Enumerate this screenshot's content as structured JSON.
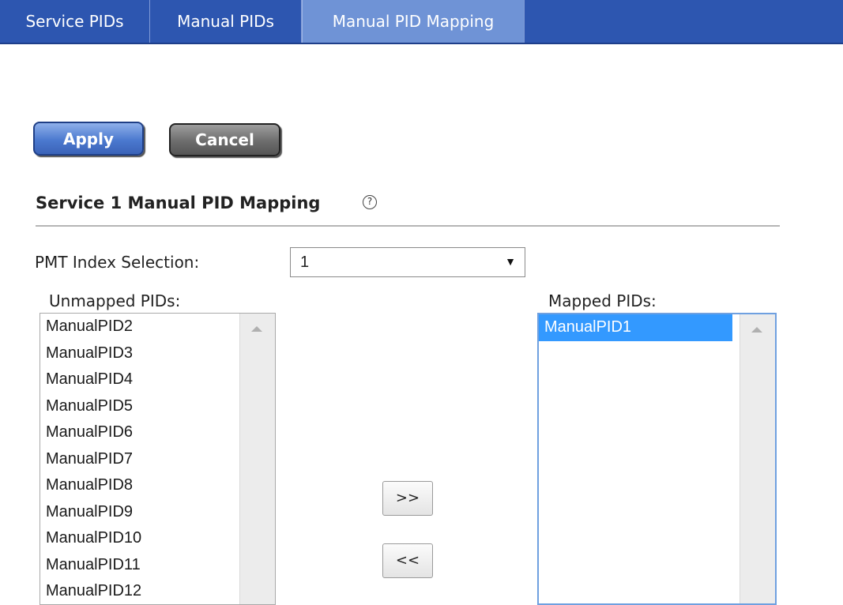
{
  "tabs": [
    {
      "label": "Service PIDs"
    },
    {
      "label": "Manual PIDs"
    },
    {
      "label": "Manual PID Mapping",
      "active": true
    }
  ],
  "buttons": {
    "apply": "Apply",
    "cancel": "Cancel",
    "move_right": ">>",
    "move_left": "<<"
  },
  "section": {
    "title": "Service 1 Manual PID Mapping",
    "help_icon": "?"
  },
  "pmt": {
    "label": "PMT Index Selection:",
    "value": "1"
  },
  "unmapped": {
    "label": "Unmapped PIDs:",
    "items": [
      "ManualPID2",
      "ManualPID3",
      "ManualPID4",
      "ManualPID5",
      "ManualPID6",
      "ManualPID7",
      "ManualPID8",
      "ManualPID9",
      "ManualPID10",
      "ManualPID11",
      "ManualPID12"
    ]
  },
  "mapped": {
    "label": "Mapped PIDs:",
    "items": [
      "ManualPID1"
    ]
  },
  "colors": {
    "tabbar": "#2d56b0",
    "active_tab": "#6f93d6",
    "selection": "#3399ff"
  }
}
